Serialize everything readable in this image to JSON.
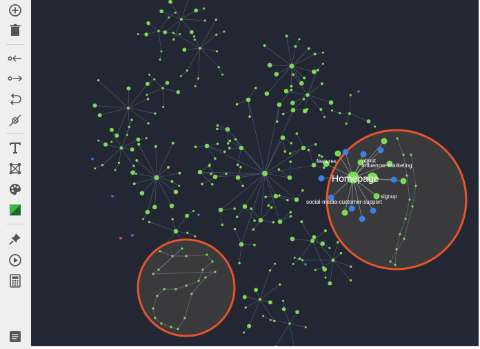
{
  "toolbar": {
    "tools": [
      {
        "name": "add-node-icon",
        "label": "Add"
      },
      {
        "name": "trash-icon",
        "label": "Delete"
      },
      {
        "name": "incoming-links-icon",
        "label": "Incoming"
      },
      {
        "name": "outgoing-links-icon",
        "label": "Outgoing"
      },
      {
        "name": "undo-icon",
        "label": "Undo"
      },
      {
        "name": "remove-link-icon",
        "label": "Remove link"
      },
      {
        "name": "text-icon",
        "label": "Text"
      },
      {
        "name": "layout-icon",
        "label": "Layout"
      },
      {
        "name": "palette-icon",
        "label": "Colors"
      },
      {
        "name": "color-toggle-icon",
        "label": "Color mode"
      },
      {
        "name": "pin-icon",
        "label": "Pin"
      },
      {
        "name": "play-icon",
        "label": "Play"
      },
      {
        "name": "calculator-icon",
        "label": "Calculator"
      },
      {
        "name": "document-icon",
        "label": "Report"
      }
    ]
  },
  "graph": {
    "labels": {
      "homepage": "Homepage",
      "features": "features",
      "about": "about",
      "influencer_marketing": "influencer-marketing",
      "signup": "signup",
      "social_support": "social-media-customer-support"
    }
  },
  "colors": {
    "background": "#222733",
    "node_green": "#7ed957",
    "node_blue": "#3d7fe6",
    "node_red": "#e05050",
    "edge": "#56607a",
    "magnifier_ring": "#e8542a",
    "magnifier_fill": "#3a3a3d",
    "toolbar_bg": "#efefef",
    "icon": "#555555",
    "accent_green": "#3bb54a"
  }
}
